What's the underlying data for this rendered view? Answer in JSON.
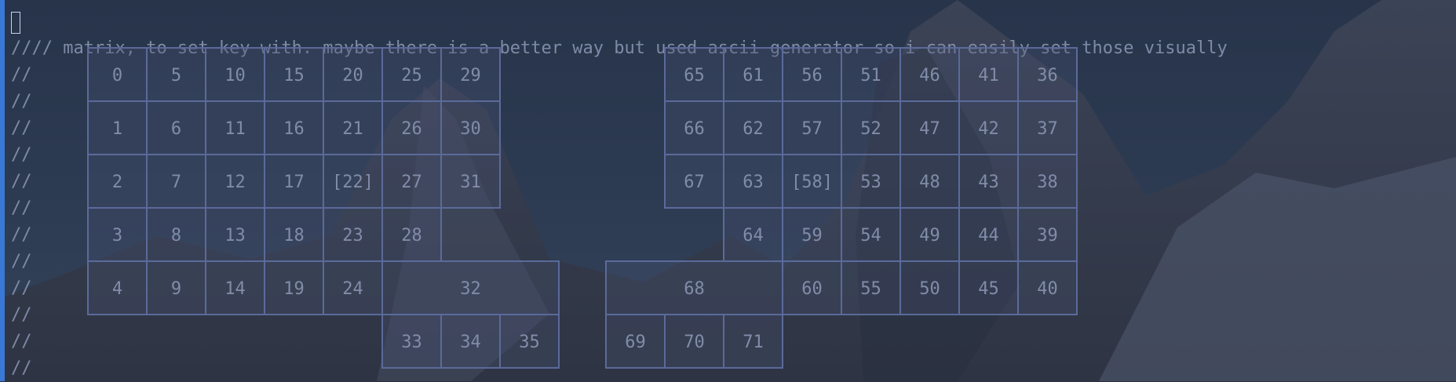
{
  "editor": {
    "comment_header": "/ matrix, to set key with. maybe there is a better way but used ascii generator so i can easily set those visually",
    "cursor_char": "/",
    "comment_prefix": "//",
    "gutter_line_count": 13
  },
  "keys": [
    {
      "id": "k0",
      "label": "0"
    },
    {
      "id": "k5",
      "label": "5"
    },
    {
      "id": "k10",
      "label": "10"
    },
    {
      "id": "k15",
      "label": "15"
    },
    {
      "id": "k20",
      "label": "20"
    },
    {
      "id": "k25",
      "label": "25"
    },
    {
      "id": "k29",
      "label": "29"
    },
    {
      "id": "k1",
      "label": "1"
    },
    {
      "id": "k6",
      "label": "6"
    },
    {
      "id": "k11",
      "label": "11"
    },
    {
      "id": "k16",
      "label": "16"
    },
    {
      "id": "k21",
      "label": "21"
    },
    {
      "id": "k26",
      "label": "26"
    },
    {
      "id": "k30",
      "label": "30"
    },
    {
      "id": "k2",
      "label": "2"
    },
    {
      "id": "k7",
      "label": "7"
    },
    {
      "id": "k12",
      "label": "12"
    },
    {
      "id": "k17",
      "label": "17"
    },
    {
      "id": "k22",
      "label": "[22]"
    },
    {
      "id": "k27",
      "label": "27"
    },
    {
      "id": "k31",
      "label": "31"
    },
    {
      "id": "k3",
      "label": "3"
    },
    {
      "id": "k8",
      "label": "8"
    },
    {
      "id": "k13",
      "label": "13"
    },
    {
      "id": "k18",
      "label": "18"
    },
    {
      "id": "k23",
      "label": "23"
    },
    {
      "id": "k28",
      "label": "28"
    },
    {
      "id": "k4",
      "label": "4"
    },
    {
      "id": "k9",
      "label": "9"
    },
    {
      "id": "k14",
      "label": "14"
    },
    {
      "id": "k19",
      "label": "19"
    },
    {
      "id": "k24",
      "label": "24"
    },
    {
      "id": "k32",
      "label": "32"
    },
    {
      "id": "k33",
      "label": "33"
    },
    {
      "id": "k34",
      "label": "34"
    },
    {
      "id": "k35",
      "label": "35"
    },
    {
      "id": "k65",
      "label": "65"
    },
    {
      "id": "k61",
      "label": "61"
    },
    {
      "id": "k56",
      "label": "56"
    },
    {
      "id": "k51",
      "label": "51"
    },
    {
      "id": "k46",
      "label": "46"
    },
    {
      "id": "k41",
      "label": "41"
    },
    {
      "id": "k36",
      "label": "36"
    },
    {
      "id": "k66",
      "label": "66"
    },
    {
      "id": "k62",
      "label": "62"
    },
    {
      "id": "k57",
      "label": "57"
    },
    {
      "id": "k52",
      "label": "52"
    },
    {
      "id": "k47",
      "label": "47"
    },
    {
      "id": "k42",
      "label": "42"
    },
    {
      "id": "k37",
      "label": "37"
    },
    {
      "id": "k67",
      "label": "67"
    },
    {
      "id": "k63",
      "label": "63"
    },
    {
      "id": "k58",
      "label": "[58]"
    },
    {
      "id": "k53",
      "label": "53"
    },
    {
      "id": "k48",
      "label": "48"
    },
    {
      "id": "k43",
      "label": "43"
    },
    {
      "id": "k38",
      "label": "38"
    },
    {
      "id": "k64",
      "label": "64"
    },
    {
      "id": "k59",
      "label": "59"
    },
    {
      "id": "k54",
      "label": "54"
    },
    {
      "id": "k49",
      "label": "49"
    },
    {
      "id": "k44",
      "label": "44"
    },
    {
      "id": "k39",
      "label": "39"
    },
    {
      "id": "k68",
      "label": "68"
    },
    {
      "id": "k60",
      "label": "60"
    },
    {
      "id": "k55",
      "label": "55"
    },
    {
      "id": "k50",
      "label": "50"
    },
    {
      "id": "k45",
      "label": "45"
    },
    {
      "id": "k40",
      "label": "40"
    },
    {
      "id": "k69",
      "label": "69"
    },
    {
      "id": "k70",
      "label": "70"
    },
    {
      "id": "k71",
      "label": "71"
    }
  ]
}
